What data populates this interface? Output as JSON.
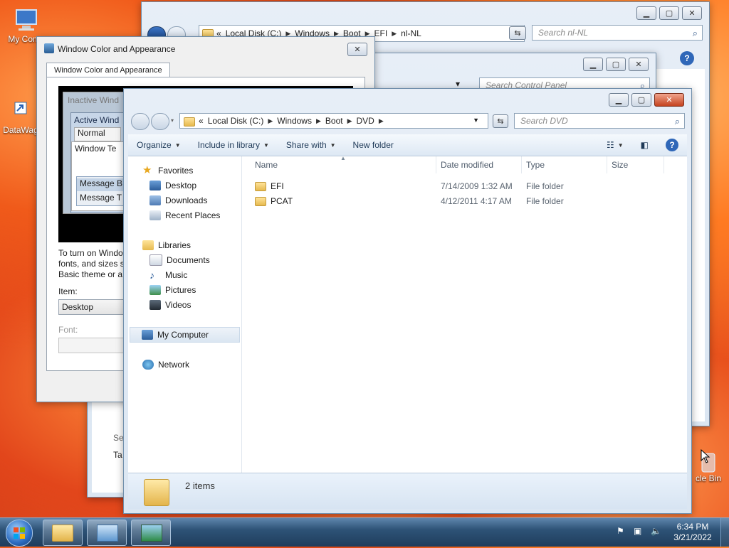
{
  "desktop": {
    "icons": [
      {
        "label": "My Comp",
        "icon": "computer-icon"
      },
      {
        "label": "DataWag",
        "icon": "shortcut-icon"
      },
      {
        "label": "cle Bin",
        "icon": "recycle-bin-icon"
      }
    ]
  },
  "back_explorer": {
    "address": [
      "«",
      "Local Disk (C:)",
      "Windows",
      "Boot",
      "EFI",
      "nl-NL"
    ],
    "search_placeholder": "Search nl-NL"
  },
  "control_panel": {
    "search_placeholder": "Search Control Panel"
  },
  "dialog": {
    "title": "Window Color and Appearance",
    "tab": "Window Color and Appearance",
    "preview": {
      "inactive": "Inactive Wind",
      "active": "Active Wind",
      "normal": "Normal",
      "window_text": "Window Te",
      "message_box": "Message B",
      "message_text": "Message T"
    },
    "help_line1": "To turn on Windo",
    "help_line2": "fonts, and sizes se",
    "help_line3": "Basic theme or a",
    "item_label": "Item:",
    "item_value": "Desktop",
    "font_label": "Font:",
    "bottom_text1": "Se",
    "bottom_text2": "Ta"
  },
  "explorer": {
    "address": [
      "«",
      "Local Disk (C:)",
      "Windows",
      "Boot",
      "DVD"
    ],
    "search_placeholder": "Search DVD",
    "toolbar": {
      "organize": "Organize",
      "include": "Include in library",
      "share": "Share with",
      "new_folder": "New folder"
    },
    "nav": {
      "favorites": "Favorites",
      "desktop": "Desktop",
      "downloads": "Downloads",
      "recent": "Recent Places",
      "libraries": "Libraries",
      "documents": "Documents",
      "music": "Music",
      "pictures": "Pictures",
      "videos": "Videos",
      "computer": "My Computer",
      "network": "Network"
    },
    "columns": {
      "name": "Name",
      "date": "Date modified",
      "type": "Type",
      "size": "Size"
    },
    "rows": [
      {
        "name": "EFI",
        "date": "7/14/2009 1:32 AM",
        "type": "File folder"
      },
      {
        "name": "PCAT",
        "date": "4/12/2011 4:17 AM",
        "type": "File folder"
      }
    ],
    "status": "2 items"
  },
  "taskbar": {
    "time": "6:34 PM",
    "date": "3/21/2022"
  },
  "colors": {
    "taskbar": "#2e5377",
    "close_button": "#c4431f"
  }
}
